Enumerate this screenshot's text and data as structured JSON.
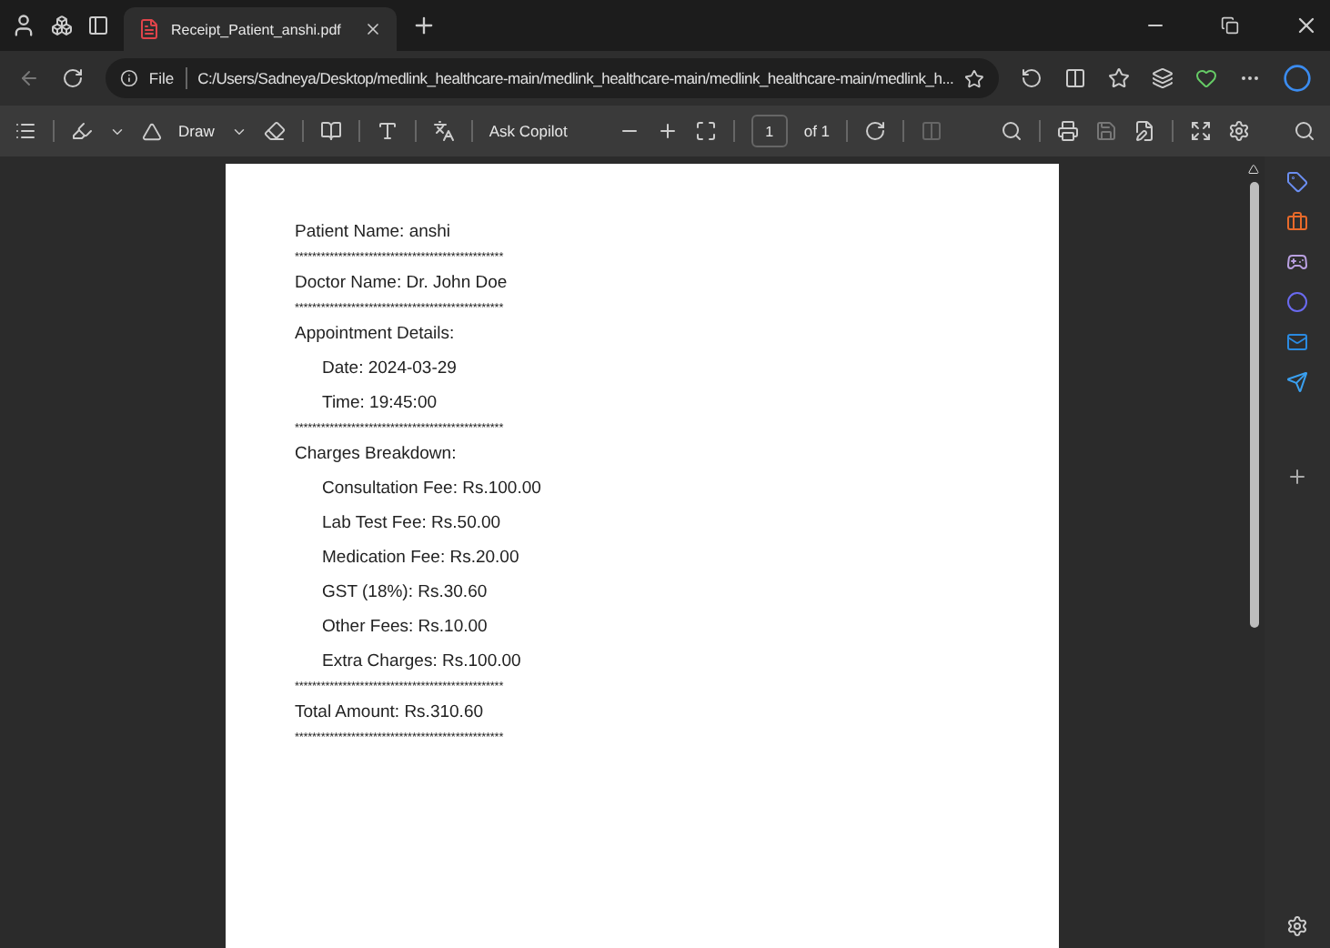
{
  "tab": {
    "title": "Receipt_Patient_anshi.pdf",
    "selected": true
  },
  "address_bar": {
    "scheme": "File",
    "url": "C:/Users/Sadneya/Desktop/medlink_healthcare-main/medlink_healthcare-main/medlink_healthcare-main/medlink_h..."
  },
  "pdf_toolbar": {
    "draw": "Draw",
    "copilot": "Ask Copilot",
    "page": "1",
    "page_total": "of 1"
  },
  "document": {
    "lines": [
      {
        "kind": "text",
        "text": "Patient Name: anshi"
      },
      {
        "kind": "separator",
        "text": "************************************************"
      },
      {
        "kind": "text",
        "text": "Doctor Name: Dr. John Doe"
      },
      {
        "kind": "separator",
        "text": "************************************************"
      },
      {
        "kind": "text",
        "text": "Appointment Details:"
      },
      {
        "kind": "indented",
        "text": "Date: 2024-03-29"
      },
      {
        "kind": "indented",
        "text": "Time: 19:45:00"
      },
      {
        "kind": "separator",
        "text": "************************************************"
      },
      {
        "kind": "text",
        "text": "Charges Breakdown:"
      },
      {
        "kind": "indented",
        "text": "Consultation Fee: Rs.100.00"
      },
      {
        "kind": "indented",
        "text": "Lab Test Fee: Rs.50.00"
      },
      {
        "kind": "indented",
        "text": "Medication Fee: Rs.20.00"
      },
      {
        "kind": "indented",
        "text": "GST (18%): Rs.30.60"
      },
      {
        "kind": "indented",
        "text": "Other Fees: Rs.10.00"
      },
      {
        "kind": "indented",
        "text": "Extra Charges: Rs.100.00"
      },
      {
        "kind": "separator",
        "text": "************************************************"
      },
      {
        "kind": "text",
        "text": "Total Amount: Rs.310.60"
      },
      {
        "kind": "separator",
        "text": "************************************************"
      }
    ]
  }
}
